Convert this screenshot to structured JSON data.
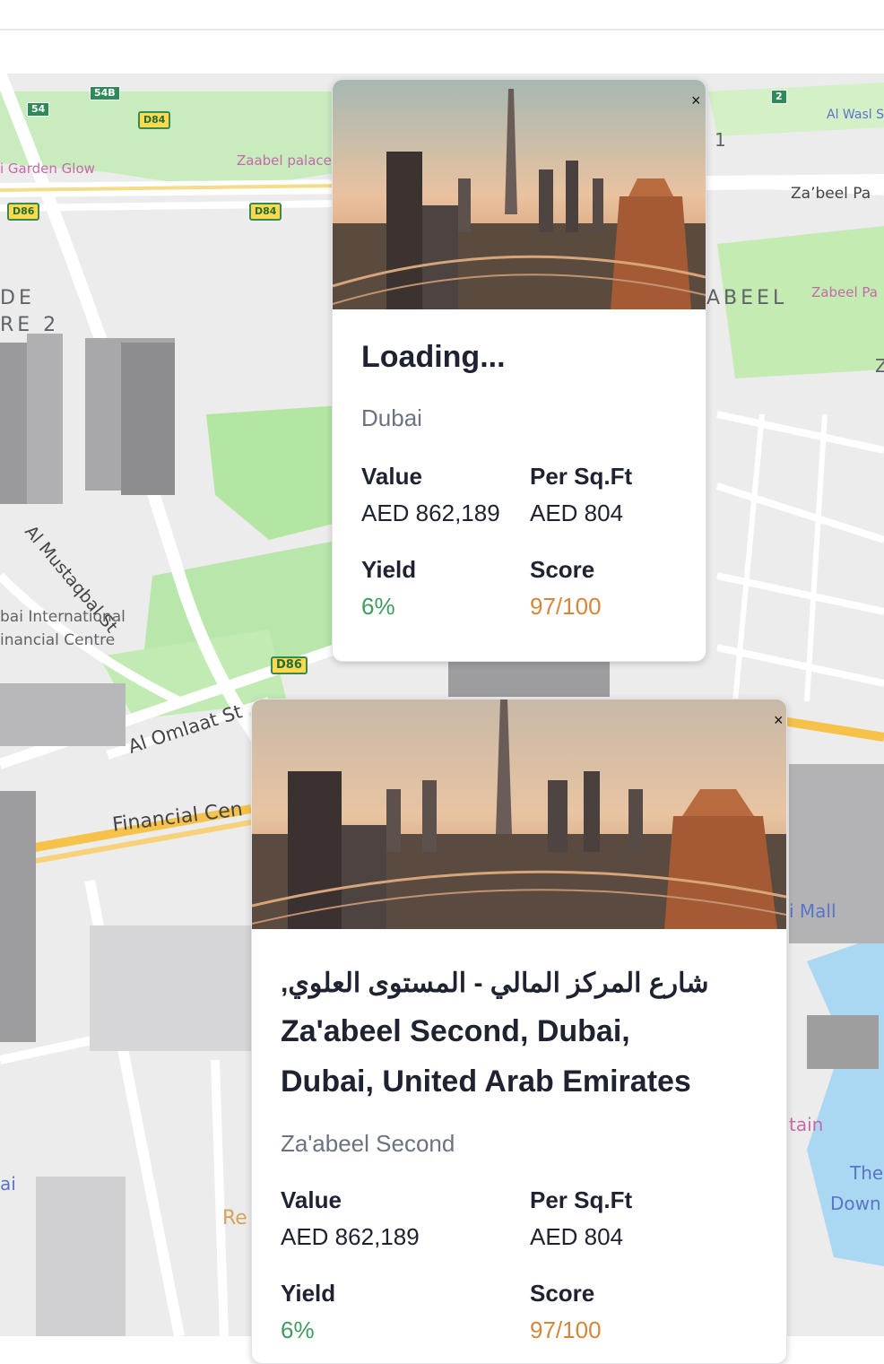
{
  "map": {
    "labels": {
      "garden_glow": "i Garden Glow",
      "zabeel_palace": "Zaabel palace",
      "al_wasl": "Al Wasl S",
      "zaabeel_park": "Za’beel Pa",
      "zabeel_park_pink": "Zabeel Pa",
      "abeel": "ABEEL",
      "de": "DE",
      "re2": "RE 2",
      "al_mustaqbal": "Al Mustaqbal St",
      "difc1": "bai International",
      "difc2": "inancial Centre",
      "al_omlaat": "Al Omlaat St",
      "financial_centre": "Financial Cen",
      "mall": "i Mall",
      "tain": "tain",
      "the_down1": "The",
      "the_down2": "Down",
      "re": "Re",
      "ai": "ai",
      "one": "1",
      "z": "Z"
    },
    "shields": {
      "s54": "54",
      "s54b": "54B",
      "d84a": "D84",
      "d86a": "D86",
      "d84b": "D84",
      "d86b": "D86",
      "s2": "2"
    }
  },
  "card_top": {
    "close": "×",
    "title": "Loading...",
    "subtitle": "Dubai",
    "stats": {
      "value_label": "Value",
      "value": "AED 862,189",
      "persqft_label": "Per Sq.Ft",
      "persqft": "AED 804",
      "yield_label": "Yield",
      "yield": "6%",
      "score_label": "Score",
      "score": "97/100"
    }
  },
  "card_bottom": {
    "close": "×",
    "title_line1": "شارع المركز المالي - المستوى العلوي,",
    "title_line2": "Za'abeel Second, Dubai,",
    "title_line3": "Dubai, United Arab Emirates",
    "subtitle": "Za'abeel Second",
    "stats": {
      "value_label": "Value",
      "value": "AED 862,189",
      "persqft_label": "Per Sq.Ft",
      "persqft": "AED 804",
      "yield_label": "Yield",
      "yield": "6%",
      "score_label": "Score",
      "score": "97/100"
    }
  }
}
